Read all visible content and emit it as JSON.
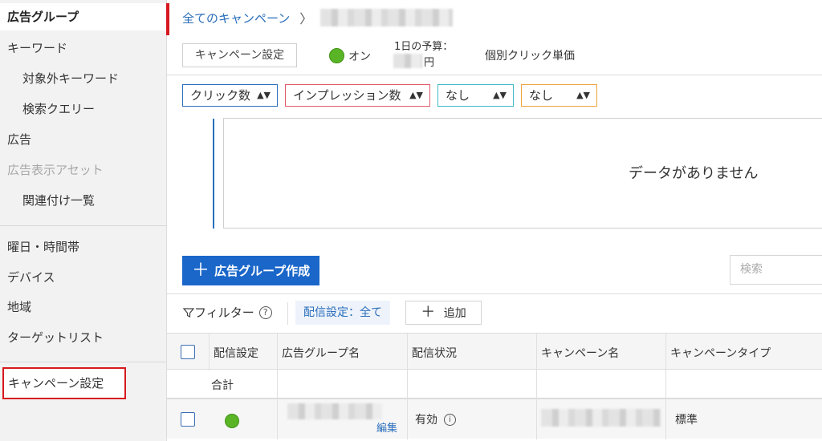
{
  "sidebar": {
    "items": [
      {
        "label": "広告グループ"
      },
      {
        "label": "キーワード"
      },
      {
        "label": "対象外キーワード"
      },
      {
        "label": "検索クエリー"
      },
      {
        "label": "広告"
      },
      {
        "label": "広告表示アセット"
      },
      {
        "label": "関連付け一覧"
      },
      {
        "label": "曜日・時間帯"
      },
      {
        "label": "デバイス"
      },
      {
        "label": "地域"
      },
      {
        "label": "ターゲットリスト"
      },
      {
        "label": "キャンペーン設定"
      }
    ]
  },
  "header": {
    "breadcrumb_link": "全てのキャンペーン",
    "breadcrumb_sep": "〉",
    "campaign_settings_button": "キャンペーン設定",
    "status_label": "オン",
    "budget_label": "1日の予算：",
    "budget_unit": "円",
    "cpc_label": "個別クリック単価"
  },
  "metrics": [
    {
      "label": "クリック数"
    },
    {
      "label": "インプレッション数"
    },
    {
      "label": "なし"
    },
    {
      "label": "なし"
    }
  ],
  "metric_arrow": "▲▼",
  "chart": {
    "no_data": "データがありません"
  },
  "toolbar": {
    "create_label": "広告グループ作成",
    "search_placeholder": "検索",
    "filter_label": "フィルター",
    "filter_chip": "配信設定：全て",
    "add_label": "追加"
  },
  "table": {
    "headers": [
      "配信設定",
      "広告グループ名",
      "配信状況",
      "キャンペーン名",
      "キャンペーンタイプ"
    ],
    "total_label": "合計",
    "row": {
      "edit": "編集",
      "status": "有効",
      "type": "標準"
    }
  },
  "colors": {
    "accent_red": "#d7191f",
    "link_blue": "#2a6ebb",
    "button_blue": "#1a66c9",
    "status_green": "#5ab526"
  }
}
